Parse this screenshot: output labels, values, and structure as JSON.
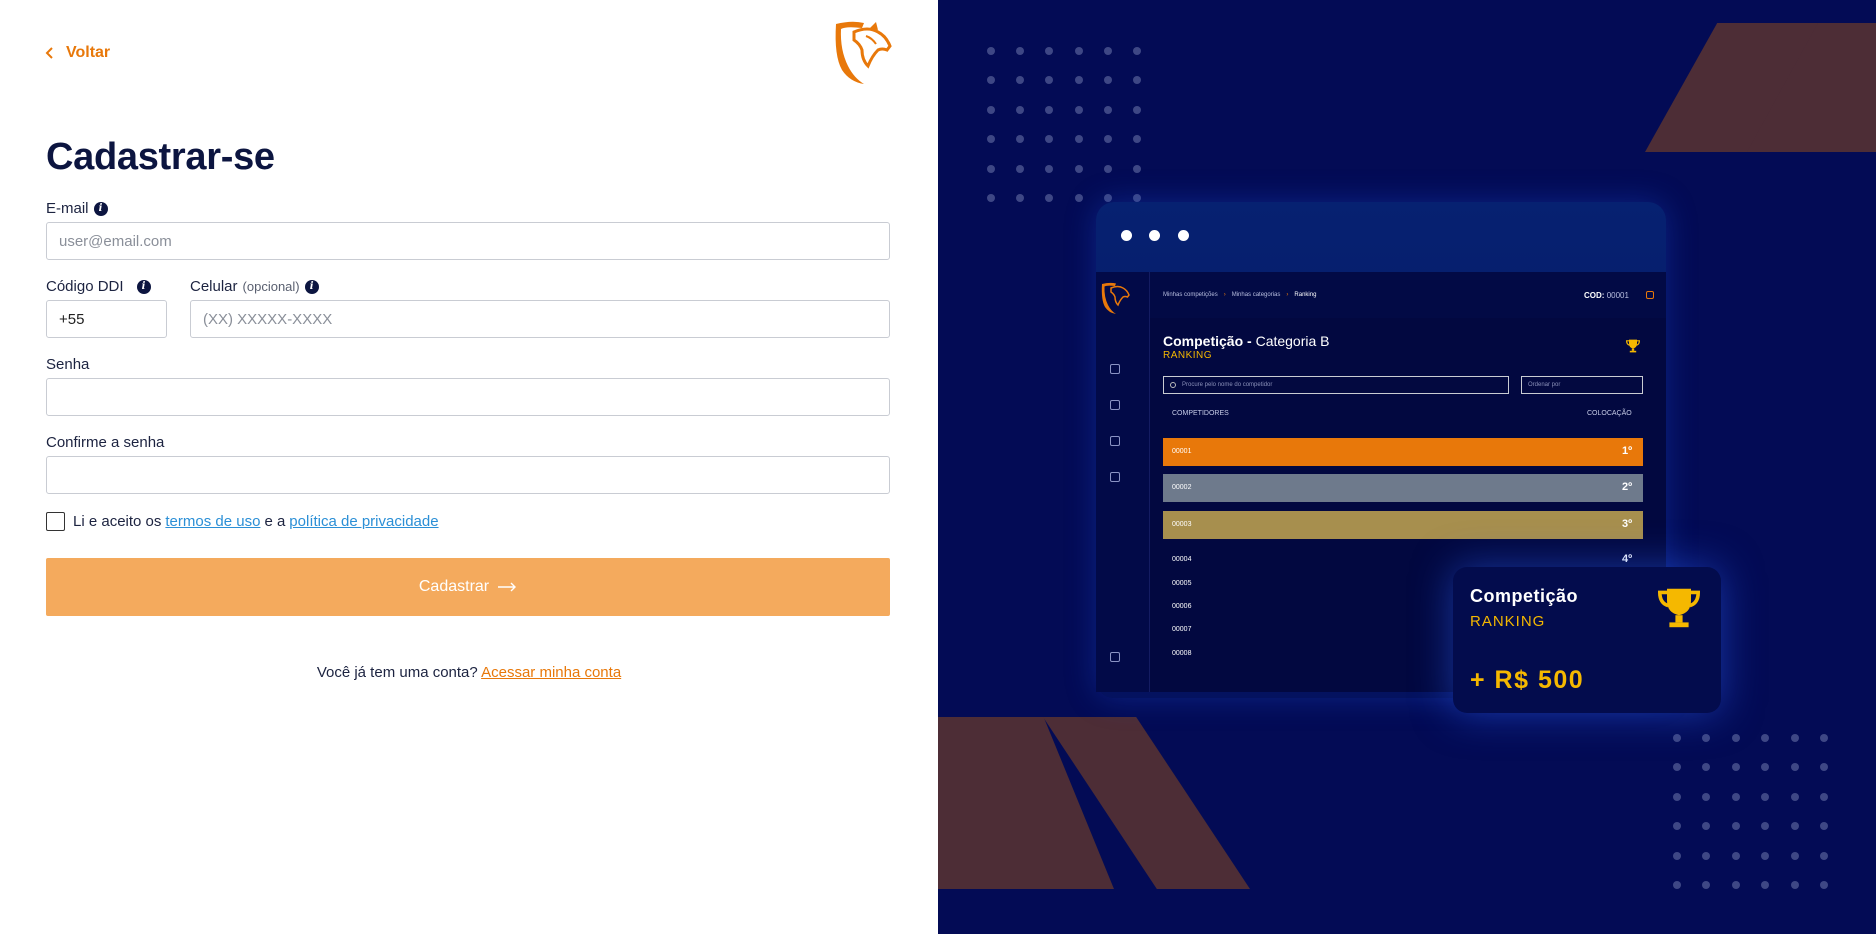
{
  "header": {
    "back_label": "Voltar"
  },
  "form": {
    "title": "Cadastrar-se",
    "email": {
      "label": "E-mail",
      "placeholder": "user@email.com",
      "value": ""
    },
    "ddi": {
      "label": "Código DDI",
      "value": "+55"
    },
    "phone": {
      "label": "Celular",
      "optional": "(opcional)",
      "placeholder": "(XX) XXXXX-XXXX",
      "value": ""
    },
    "password": {
      "label": "Senha",
      "value": ""
    },
    "confirm": {
      "label": "Confirme a senha",
      "value": ""
    },
    "terms": {
      "prefix": "Li e aceito os",
      "terms_link": "termos de uso",
      "middle": "e a",
      "privacy_link": "política de privacidade",
      "checked": false
    },
    "submit_label": "Cadastrar",
    "login_prompt": "Você já tem uma conta?",
    "login_link": "Acessar minha conta"
  },
  "showcase": {
    "breadcrumb": [
      "Minhas competições",
      "Minhas categorias",
      "Ranking"
    ],
    "cod_label": "COD:",
    "cod_value": "00001",
    "title_bold": "Competição -",
    "title_light": "Categoria B",
    "subtitle": "RANKING",
    "search_placeholder": "Procure pelo nome do competidor",
    "sort_placeholder": "Ordenar por",
    "col_competitors": "COMPETIDORES",
    "col_place": "COLOCAÇÃO",
    "rows": [
      {
        "code": "00001",
        "place": "1º",
        "color": "#e8780a"
      },
      {
        "code": "00002",
        "place": "2º",
        "color": "#6e7a8c"
      },
      {
        "code": "00003",
        "place": "3º",
        "color": "#a78f4e"
      },
      {
        "code": "00004",
        "place": "4º",
        "color": ""
      },
      {
        "code": "00005",
        "place": "",
        "color": ""
      },
      {
        "code": "00006",
        "place": "",
        "color": ""
      },
      {
        "code": "00007",
        "place": "",
        "color": ""
      },
      {
        "code": "00008",
        "place": "",
        "color": ""
      }
    ],
    "card": {
      "title": "Competição",
      "subtitle": "RANKING",
      "amount": "+ R$ 500"
    }
  },
  "colors": {
    "accent": "#e8780a",
    "button_disabled": "#f4aa5d",
    "panel_bg": "#030b55",
    "stripe": "#4d2d36",
    "gold": "#f5b800"
  }
}
